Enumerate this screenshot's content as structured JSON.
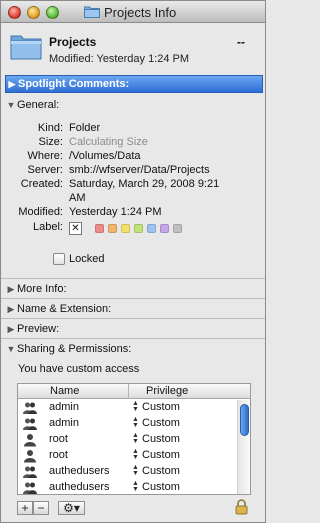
{
  "window": {
    "title": "Projects Info"
  },
  "header": {
    "name": "Projects",
    "size": "--",
    "modified": "Modified: Yesterday 1:24 PM"
  },
  "sections": {
    "spotlight": "Spotlight Comments:",
    "general": "General:",
    "more_info": "More Info:",
    "name_extension": "Name & Extension:",
    "preview": "Preview:",
    "sharing": "Sharing & Permissions:"
  },
  "general": {
    "kind_label": "Kind:",
    "kind": "Folder",
    "size_label": "Size:",
    "size": "Calculating Size",
    "where_label": "Where:",
    "where": "/Volumes/Data",
    "server_label": "Server:",
    "server": "smb://wfserver/Data/Projects",
    "created_label": "Created:",
    "created_line1": "Saturday, March 29, 2008 9:21",
    "created_line2": "AM",
    "modified_label": "Modified:",
    "modified": "Yesterday 1:24 PM",
    "label_label": "Label:",
    "label_none": "✕",
    "label_colors": [
      "#f08a8a",
      "#f2b36b",
      "#f2e06b",
      "#c4e27a",
      "#9ec3f0",
      "#c7a6e8",
      "#c0c0c0"
    ],
    "locked_label": "Locked"
  },
  "sharing": {
    "custom_access": "You have custom access",
    "col_name": "Name",
    "col_privilege": "Privilege",
    "rows": [
      {
        "name": "admin",
        "privilege": "Custom",
        "icon": "group-icon"
      },
      {
        "name": "admin",
        "privilege": "Custom",
        "icon": "group-icon"
      },
      {
        "name": "root",
        "privilege": "Custom",
        "icon": "user-icon"
      },
      {
        "name": "root",
        "privilege": "Custom",
        "icon": "user-icon"
      },
      {
        "name": "authedusers",
        "privilege": "Custom",
        "icon": "group-icon"
      },
      {
        "name": "authedusers",
        "privilege": "Custom",
        "icon": "group-icon"
      }
    ]
  },
  "toolbar": {
    "add": "+",
    "remove": "−",
    "action": "⚙▾"
  },
  "colors": {
    "accent_blue": "#2f6fd6"
  }
}
